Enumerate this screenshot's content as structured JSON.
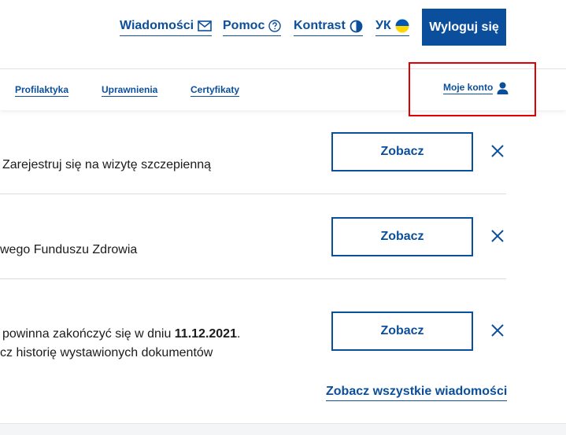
{
  "header": {
    "messages_label": "Wiadomości",
    "messages_icon": "envelope-icon",
    "help_label": "Pomoc",
    "help_icon": "question-circle-icon",
    "contrast_label": "Kontrast",
    "contrast_icon": "half-circle-icon",
    "language_label": "УК",
    "language_icon": "ukraine-flag-icon",
    "logout_label": "Wyloguj się"
  },
  "nav": {
    "items": [
      {
        "label": "Profilaktyka"
      },
      {
        "label": "Uprawnienia"
      },
      {
        "label": "Certyfikaty"
      }
    ],
    "account_label": "Moje konto",
    "account_icon": "user-icon"
  },
  "messages": [
    {
      "lines": [
        "Zarejestruj się na wizytę szczepienną"
      ],
      "button": "Zobacz"
    },
    {
      "lines": [
        "wego Funduszu Zdrowia"
      ],
      "button": "Zobacz"
    },
    {
      "line1_prefix": "powinna zakończyć się w dniu ",
      "line1_bold": "11.12.2021",
      "line1_suffix": ".",
      "line2": "cz historię wystawionych dokumentów",
      "button": "Zobacz"
    }
  ],
  "see_all_label": "Zobacz wszystkie wiadomości",
  "colors": {
    "primary": "#0b4f9c",
    "highlight": "#e00000",
    "flag_blue": "#0057b7",
    "flag_yellow": "#ffd700"
  }
}
